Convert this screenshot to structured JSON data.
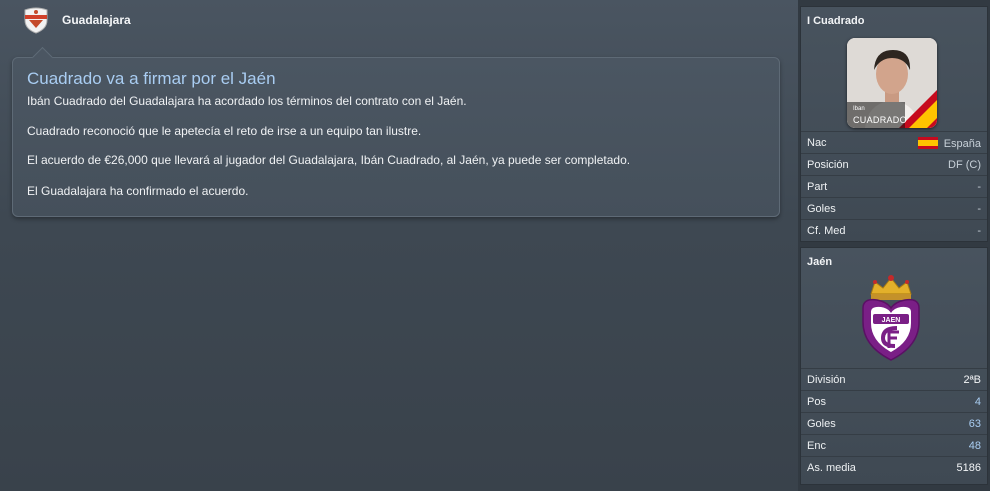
{
  "header": {
    "club_name": "Guadalajara"
  },
  "news": {
    "title": "Cuadrado va a firmar por el Jaén",
    "paragraphs": [
      "Ibán Cuadrado del Guadalajara ha acordado los términos del contrato con el Jaén.",
      "Cuadrado reconoció que le apetecía el reto de irse a un equipo tan ilustre.",
      "El acuerdo de €26,000 que llevará al jugador del Guadalajara, Ibán Cuadrado, al Jaén, ya puede ser completado.",
      "El Guadalajara ha confirmado el acuerdo."
    ]
  },
  "player": {
    "panel_title": "I Cuadrado",
    "photo_first_name": "Iban",
    "photo_last_name": "CUADRADO",
    "stats": [
      {
        "label": "Nac",
        "value": "España"
      },
      {
        "label": "Posición",
        "value": "DF (C)"
      },
      {
        "label": "Part",
        "value": "-"
      },
      {
        "label": "Goles",
        "value": "-"
      },
      {
        "label": "Cf. Med",
        "value": "-"
      }
    ]
  },
  "club": {
    "panel_title": "Jaén",
    "crest_text": "JAEN",
    "stats": [
      {
        "label": "División",
        "value": "2ªB"
      },
      {
        "label": "Pos",
        "value": "4"
      },
      {
        "label": "Goles",
        "value": "63"
      },
      {
        "label": "Enc",
        "value": "48"
      },
      {
        "label": "As. media",
        "value": "5186"
      }
    ]
  },
  "colors": {
    "accent_blue": "#a9cdf2",
    "background": "#3e4852",
    "side_background": "#323a42"
  }
}
